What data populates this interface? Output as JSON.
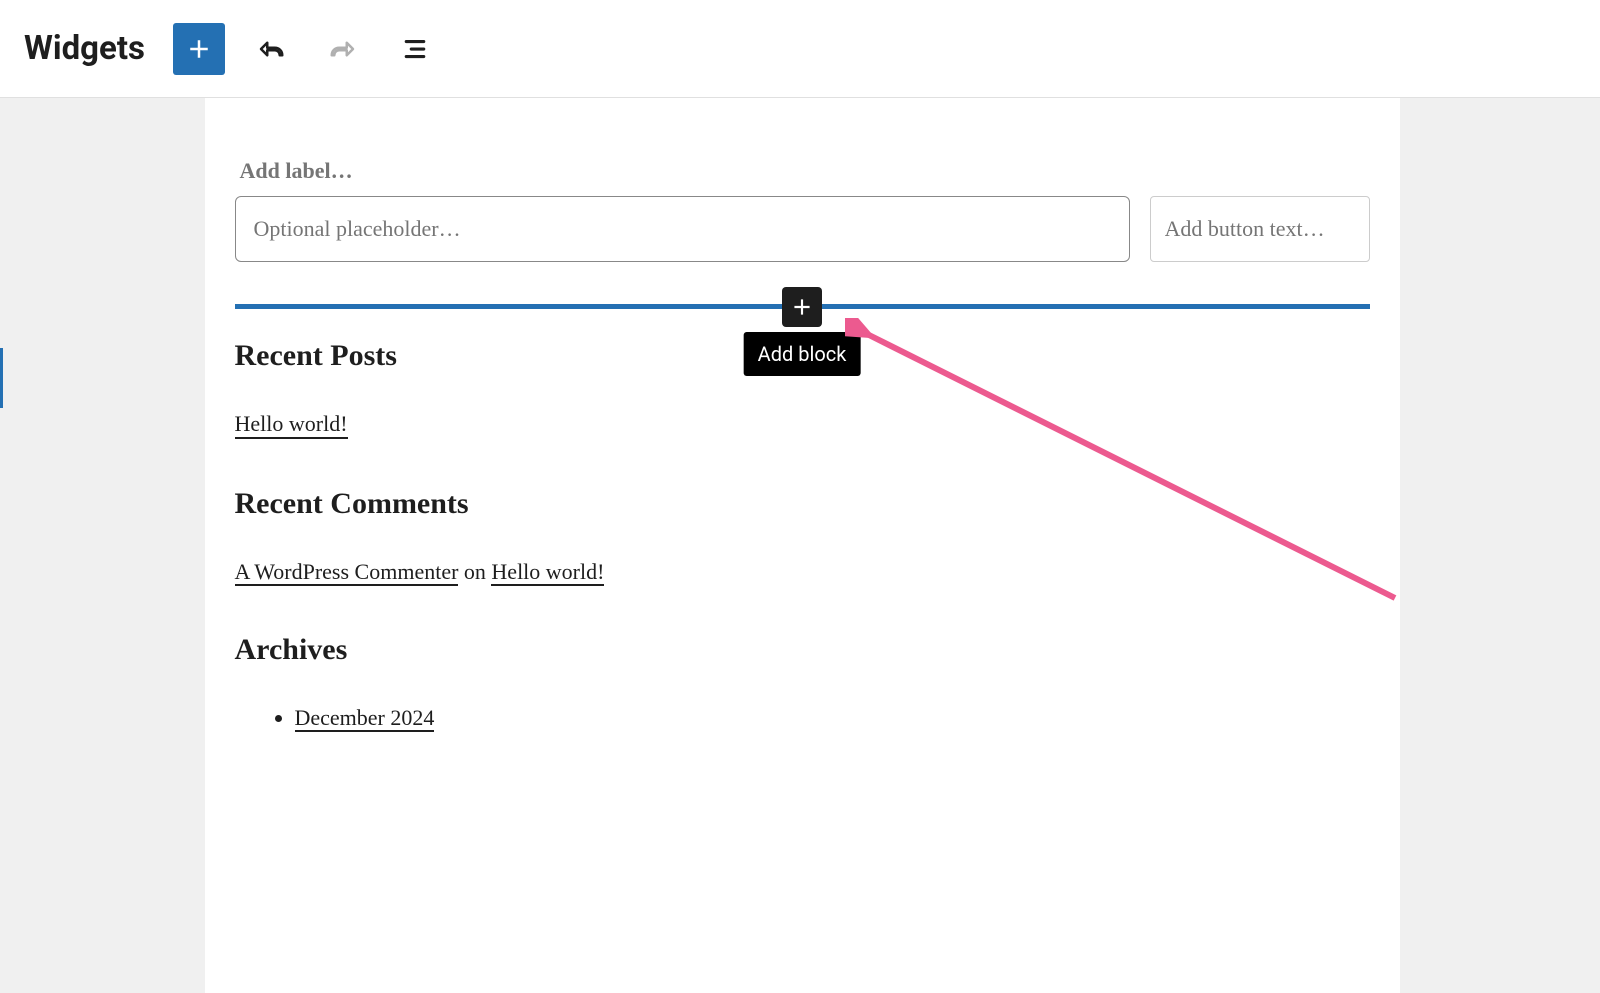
{
  "header": {
    "title": "Widgets"
  },
  "search_block": {
    "label_placeholder": "Add label…",
    "input_placeholder": "Optional placeholder…",
    "button_placeholder": "Add button text…"
  },
  "inserter": {
    "tooltip": "Add block"
  },
  "widgets": {
    "recent_posts": {
      "heading": "Recent Posts",
      "items": [
        {
          "title": "Hello world!"
        }
      ]
    },
    "recent_comments": {
      "heading": "Recent Comments",
      "items": [
        {
          "author": "A WordPress Commenter",
          "connector": "on",
          "post": "Hello world!"
        }
      ]
    },
    "archives": {
      "heading": "Archives",
      "items": [
        {
          "label": "December 2024"
        }
      ]
    }
  }
}
